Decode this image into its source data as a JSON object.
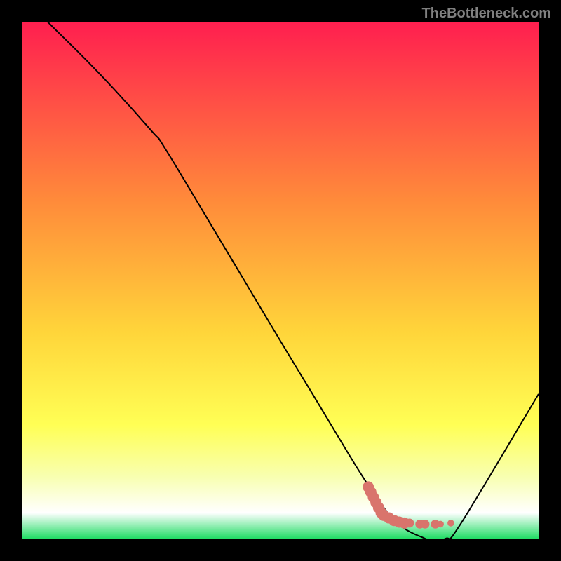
{
  "watermark": "TheBottleneck.com",
  "chart_data": {
    "type": "line",
    "title": "",
    "xlabel": "",
    "ylabel": "",
    "xlim": [
      0,
      100
    ],
    "ylim": [
      0,
      100
    ],
    "gradient_stops": [
      {
        "offset": 0,
        "color": "#ff1f4f"
      },
      {
        "offset": 35,
        "color": "#ff8c3a"
      },
      {
        "offset": 60,
        "color": "#ffd53a"
      },
      {
        "offset": 78,
        "color": "#ffff55"
      },
      {
        "offset": 88,
        "color": "#f8ffb0"
      },
      {
        "offset": 95,
        "color": "#ffffff"
      },
      {
        "offset": 100,
        "color": "#22dd66"
      }
    ],
    "series": [
      {
        "name": "bottleneck-curve",
        "color": "#000000",
        "stroke_width": 2,
        "x": [
          0,
          5,
          15,
          25,
          28,
          40,
          55,
          70,
          78,
          82,
          85,
          100
        ],
        "y": [
          105,
          100,
          90,
          79,
          75,
          55,
          30,
          6,
          0,
          0,
          3,
          28
        ]
      }
    ],
    "highlight_points": {
      "name": "target-zone",
      "color": "#d9746c",
      "points": [
        {
          "x": 67,
          "y": 10,
          "r": 5
        },
        {
          "x": 67.5,
          "y": 9,
          "r": 5
        },
        {
          "x": 68,
          "y": 8,
          "r": 5
        },
        {
          "x": 68.5,
          "y": 7,
          "r": 5
        },
        {
          "x": 69,
          "y": 6,
          "r": 5
        },
        {
          "x": 69.5,
          "y": 5,
          "r": 5
        },
        {
          "x": 70,
          "y": 4.5,
          "r": 5
        },
        {
          "x": 71,
          "y": 4,
          "r": 5
        },
        {
          "x": 72,
          "y": 3.5,
          "r": 5
        },
        {
          "x": 73,
          "y": 3.2,
          "r": 5
        },
        {
          "x": 74,
          "y": 3,
          "r": 5
        },
        {
          "x": 75,
          "y": 3,
          "r": 4
        },
        {
          "x": 77,
          "y": 2.8,
          "r": 4
        },
        {
          "x": 78,
          "y": 2.8,
          "r": 4
        },
        {
          "x": 80,
          "y": 2.8,
          "r": 4
        },
        {
          "x": 81,
          "y": 2.8,
          "r": 3
        },
        {
          "x": 83,
          "y": 3,
          "r": 3
        }
      ]
    }
  }
}
